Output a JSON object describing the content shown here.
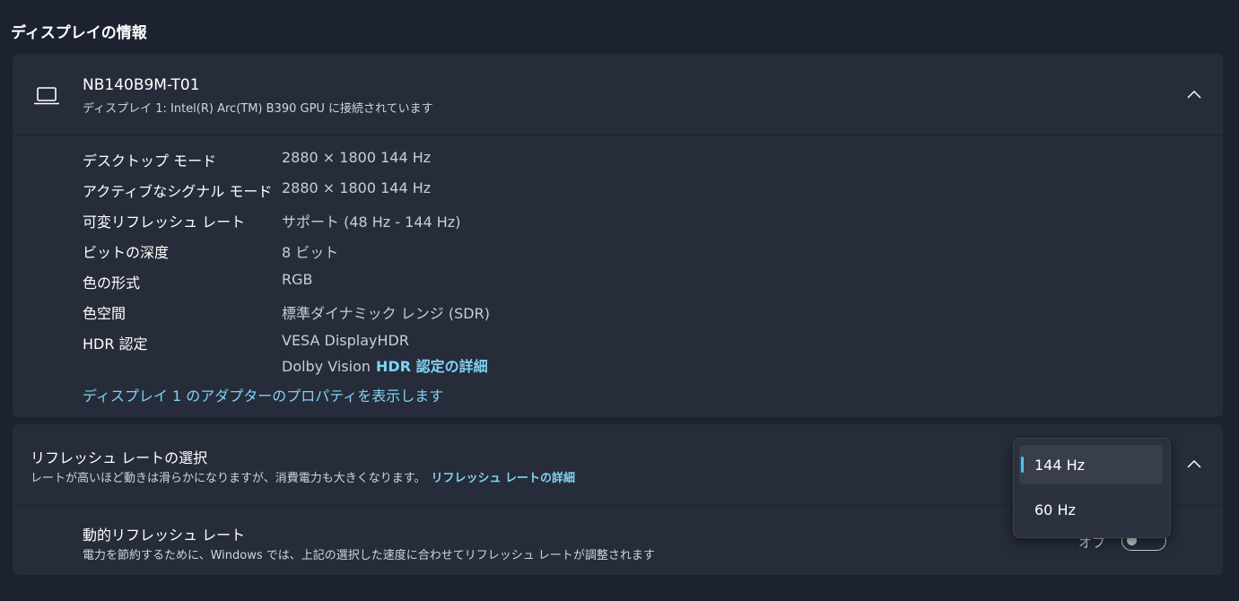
{
  "section_title": "ディスプレイの情報",
  "display": {
    "name": "NB140B9M-T01",
    "subtitle": "ディスプレイ 1: Intel(R) Arc(TM) B390 GPU に接続されています",
    "rows": [
      {
        "label": "デスクトップ モード",
        "value": "2880 × 1800 144 Hz"
      },
      {
        "label": "アクティブなシグナル モード",
        "value": "2880 × 1800 144 Hz"
      },
      {
        "label": "可変リフレッシュ レート",
        "value": "サポート (48 Hz - 144 Hz)"
      },
      {
        "label": "ビットの深度",
        "value": "8 ビット"
      },
      {
        "label": "色の形式",
        "value": "RGB"
      },
      {
        "label": "色空間",
        "value": "標準ダイナミック レンジ (SDR)"
      },
      {
        "label": "HDR 認定",
        "value": "VESA DisplayHDR",
        "value2": "Dolby Vision",
        "link": "HDR 認定の詳細"
      }
    ],
    "adapter_link": "ディスプレイ 1 のアダプターのプロパティを表示します"
  },
  "refresh": {
    "title": "リフレッシュ レートの選択",
    "subtitle": "レートが高いほど動きは滑らかになりますが、消費電力も大きくなります。",
    "link": "リフレッシュ レートの詳細",
    "options": [
      "144 Hz",
      "60 Hz"
    ],
    "selected": "144 Hz",
    "dynamic_title": "動的リフレッシュ レート",
    "dynamic_subtitle": "電力を節約するために、Windows では、上記の選択した速度に合わせてリフレッシュ レートが調整されます",
    "toggle_label": "オフ",
    "toggle_on": false
  },
  "colors": {
    "background": "#1c2230",
    "card": "#262c39",
    "accent": "#4cc2ff",
    "link": "#7fd3f5"
  }
}
